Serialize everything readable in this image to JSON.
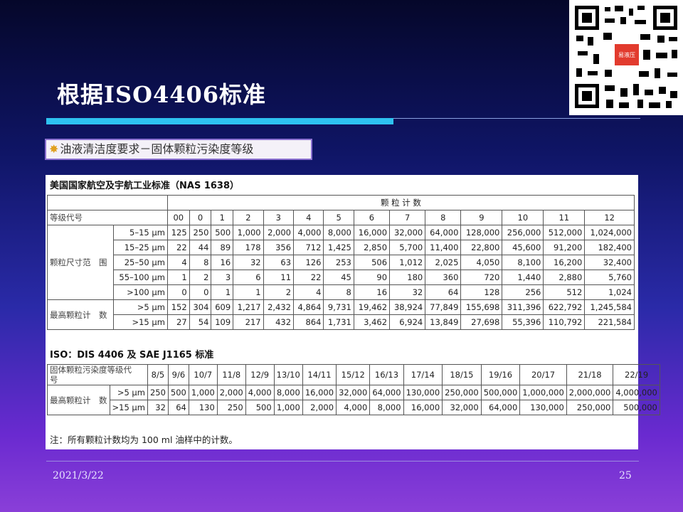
{
  "slide": {
    "title": "根据ISO4406标准",
    "subtitle": "油液清洁度要求－固体颗粒污染度等级",
    "date": "2021/3/22",
    "page_number": "25",
    "qr_label": "易液压",
    "colors": {
      "accent_bar": "#2ec2f0",
      "subtitle_border": "#8a6fd0"
    }
  },
  "nas": {
    "caption": "美国国家航空及宇航工业标准（NAS 1638）",
    "count_header": "颗 粒 计 数",
    "grade_label": "等级代号",
    "grades": [
      "00",
      "0",
      "1",
      "2",
      "3",
      "4",
      "5",
      "6",
      "7",
      "8",
      "9",
      "10",
      "11",
      "12"
    ],
    "size_group_label": "颗粒尺寸范　围",
    "max_group_label": "最高颗粒计　数",
    "size_rows": [
      {
        "range": "5–15 μm",
        "values": [
          "125",
          "250",
          "500",
          "1,000",
          "2,000",
          "4,000",
          "8,000",
          "16,000",
          "32,000",
          "64,000",
          "128,000",
          "256,000",
          "512,000",
          "1,024,000"
        ]
      },
      {
        "range": "15–25 μm",
        "values": [
          "22",
          "44",
          "89",
          "178",
          "356",
          "712",
          "1,425",
          "2,850",
          "5,700",
          "11,400",
          "22,800",
          "45,600",
          "91,200",
          "182,400"
        ]
      },
      {
        "range": "25–50 μm",
        "values": [
          "4",
          "8",
          "16",
          "32",
          "63",
          "126",
          "253",
          "506",
          "1,012",
          "2,025",
          "4,050",
          "8,100",
          "16,200",
          "32,400"
        ]
      },
      {
        "range": "55–100 μm",
        "values": [
          "1",
          "2",
          "3",
          "6",
          "11",
          "22",
          "45",
          "90",
          "180",
          "360",
          "720",
          "1,440",
          "2,880",
          "5,760"
        ]
      },
      {
        "range": ">100 μm",
        "values": [
          "0",
          "0",
          "1",
          "1",
          "2",
          "4",
          "8",
          "16",
          "32",
          "64",
          "128",
          "256",
          "512",
          "1,024"
        ]
      }
    ],
    "max_rows": [
      {
        "range": ">5 μm",
        "values": [
          "152",
          "304",
          "609",
          "1,217",
          "2,432",
          "4,864",
          "9,731",
          "19,462",
          "38,924",
          "77,849",
          "155,698",
          "311,396",
          "622,792",
          "1,245,584"
        ]
      },
      {
        "range": ">15 μm",
        "values": [
          "27",
          "54",
          "109",
          "217",
          "432",
          "864",
          "1,731",
          "3,462",
          "6,924",
          "13,849",
          "27,698",
          "55,396",
          "110,792",
          "221,584"
        ]
      }
    ]
  },
  "iso": {
    "caption": "ISO：DIS 4406 及 SAE J1165 标准",
    "code_label": "固体颗粒污染度等级代　　号",
    "codes": [
      "8/5",
      "9/6",
      "10/7",
      "11/8",
      "12/9",
      "13/10",
      "14/11",
      "15/12",
      "16/13",
      "17/14",
      "18/15",
      "19/16",
      "20/17",
      "21/18",
      "22/19"
    ],
    "max_group_label": "最高颗粒计　数",
    "rows": [
      {
        "range": ">5 μm",
        "values": [
          "250",
          "500",
          "1,000",
          "2,000",
          "4,000",
          "8,000",
          "16,000",
          "32,000",
          "64,000",
          "130,000",
          "250,000",
          "500,000",
          "1,000,000",
          "2,000,000",
          "4,000,000"
        ]
      },
      {
        "range": ">15 μm",
        "values": [
          "32",
          "64",
          "130",
          "250",
          "500",
          "1,000",
          "2,000",
          "4,000",
          "8,000",
          "16,000",
          "32,000",
          "64,000",
          "130,000",
          "250,000",
          "500,000"
        ]
      }
    ]
  },
  "note": "注：所有颗粒计数均为 100 ml 油样中的计数。"
}
